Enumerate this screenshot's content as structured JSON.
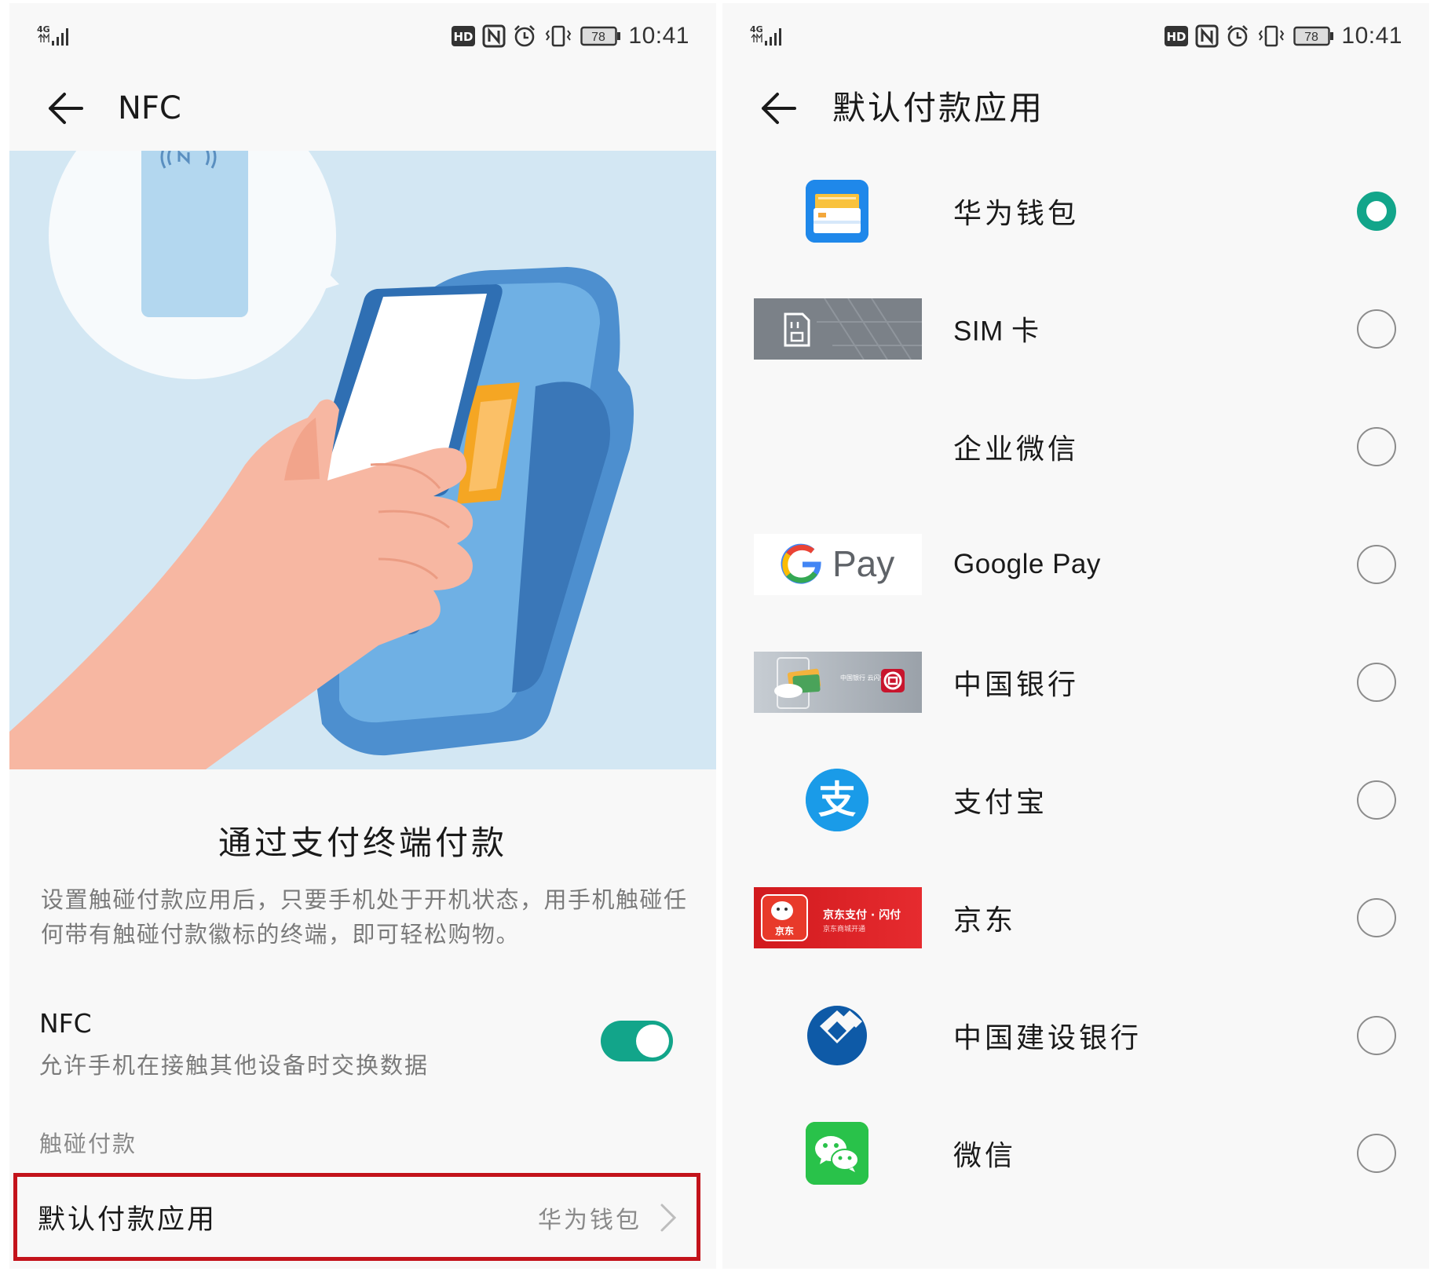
{
  "status_bar": {
    "time": "10:41",
    "battery": "78",
    "network": "4G",
    "hd": "HD"
  },
  "left": {
    "title": "NFC",
    "heading": "通过支付终端付款",
    "description": "设置触碰付款应用后，只要手机处于开机状态，用手机触碰任何带有触碰付款徽标的终端，即可轻松购物。",
    "nfc_setting": {
      "title": "NFC",
      "subtitle": "允许手机在接触其他设备时交换数据",
      "enabled": true
    },
    "group_label": "触碰付款",
    "default_payment": {
      "label": "默认付款应用",
      "value": "华为钱包"
    }
  },
  "right": {
    "title": "默认付款应用",
    "apps": [
      {
        "name": "华为钱包",
        "icon": "huawei-wallet-icon",
        "selected": true
      },
      {
        "name": "SIM 卡",
        "icon": "sim-card-icon",
        "selected": false
      },
      {
        "name": "企业微信",
        "icon": "",
        "selected": false
      },
      {
        "name": "Google Pay",
        "icon": "google-pay-icon",
        "selected": false,
        "logo_text": "Pay"
      },
      {
        "name": "中国银行",
        "icon": "bank-of-china-icon",
        "selected": false,
        "logo_text": "中国银行 云闪付"
      },
      {
        "name": "支付宝",
        "icon": "alipay-icon",
        "selected": false,
        "logo_text": "支"
      },
      {
        "name": "京东",
        "icon": "jd-icon",
        "selected": false,
        "logo_text": "京东支付 · 闪付",
        "logo_subtext": "京东商城开通",
        "logo_badge": "京东"
      },
      {
        "name": "中国建设银行",
        "icon": "ccb-icon",
        "selected": false
      },
      {
        "name": "微信",
        "icon": "wechat-icon",
        "selected": false
      }
    ]
  },
  "colors": {
    "accent": "#12a58a",
    "highlight": "#c3131b",
    "illustration_bg": "#d3e7f3"
  }
}
